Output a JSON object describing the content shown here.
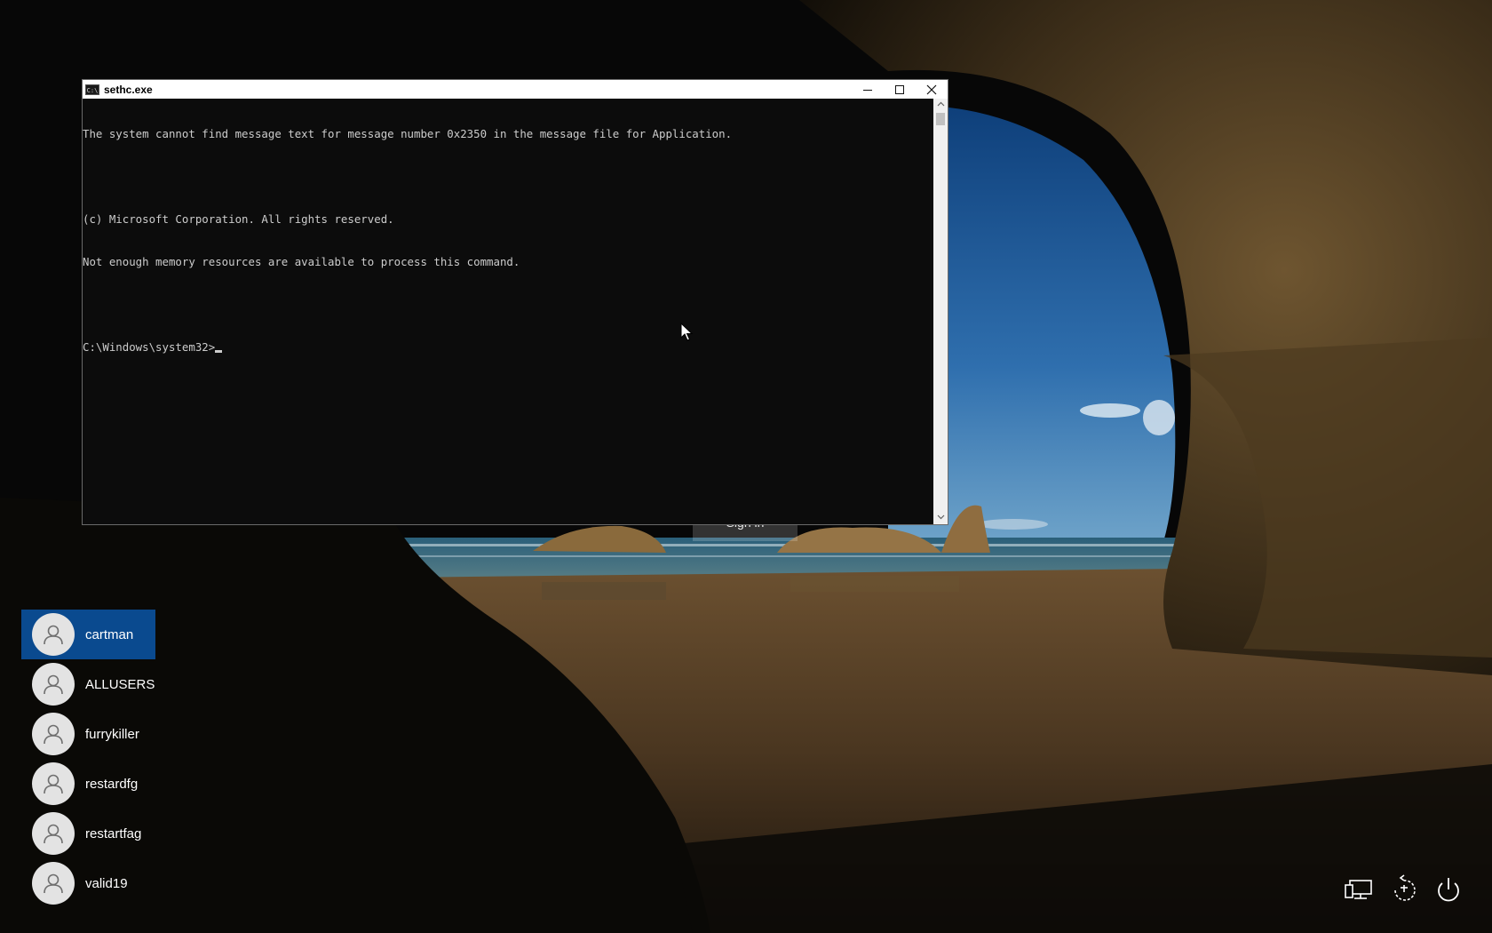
{
  "console": {
    "title": "sethc.exe",
    "icon_text": "C:\\",
    "lines": [
      "The system cannot find message text for message number 0x2350 in the message file for Application.",
      "",
      "(c) Microsoft Corporation. All rights reserved.",
      "Not enough memory resources are available to process this command.",
      "",
      "C:\\Windows\\system32>"
    ],
    "controls": {
      "minimize_icon": "minimize-icon",
      "maximize_icon": "maximize-icon",
      "close_icon": "close-icon"
    }
  },
  "lock_screen": {
    "sign_in_label": "Sign in",
    "users": [
      {
        "name": "cartman",
        "selected": true
      },
      {
        "name": "ALLUSERS",
        "selected": false
      },
      {
        "name": "furrykiller",
        "selected": false
      },
      {
        "name": "restardfg",
        "selected": false
      },
      {
        "name": "restartfag",
        "selected": false
      },
      {
        "name": "valid19",
        "selected": false
      }
    ],
    "system_icons": [
      "network-icon",
      "ease-of-access-icon",
      "power-icon"
    ]
  },
  "colors": {
    "selected_user": "#0a4a8f",
    "console_bg": "#0c0c0c",
    "console_text": "#cccccc"
  }
}
